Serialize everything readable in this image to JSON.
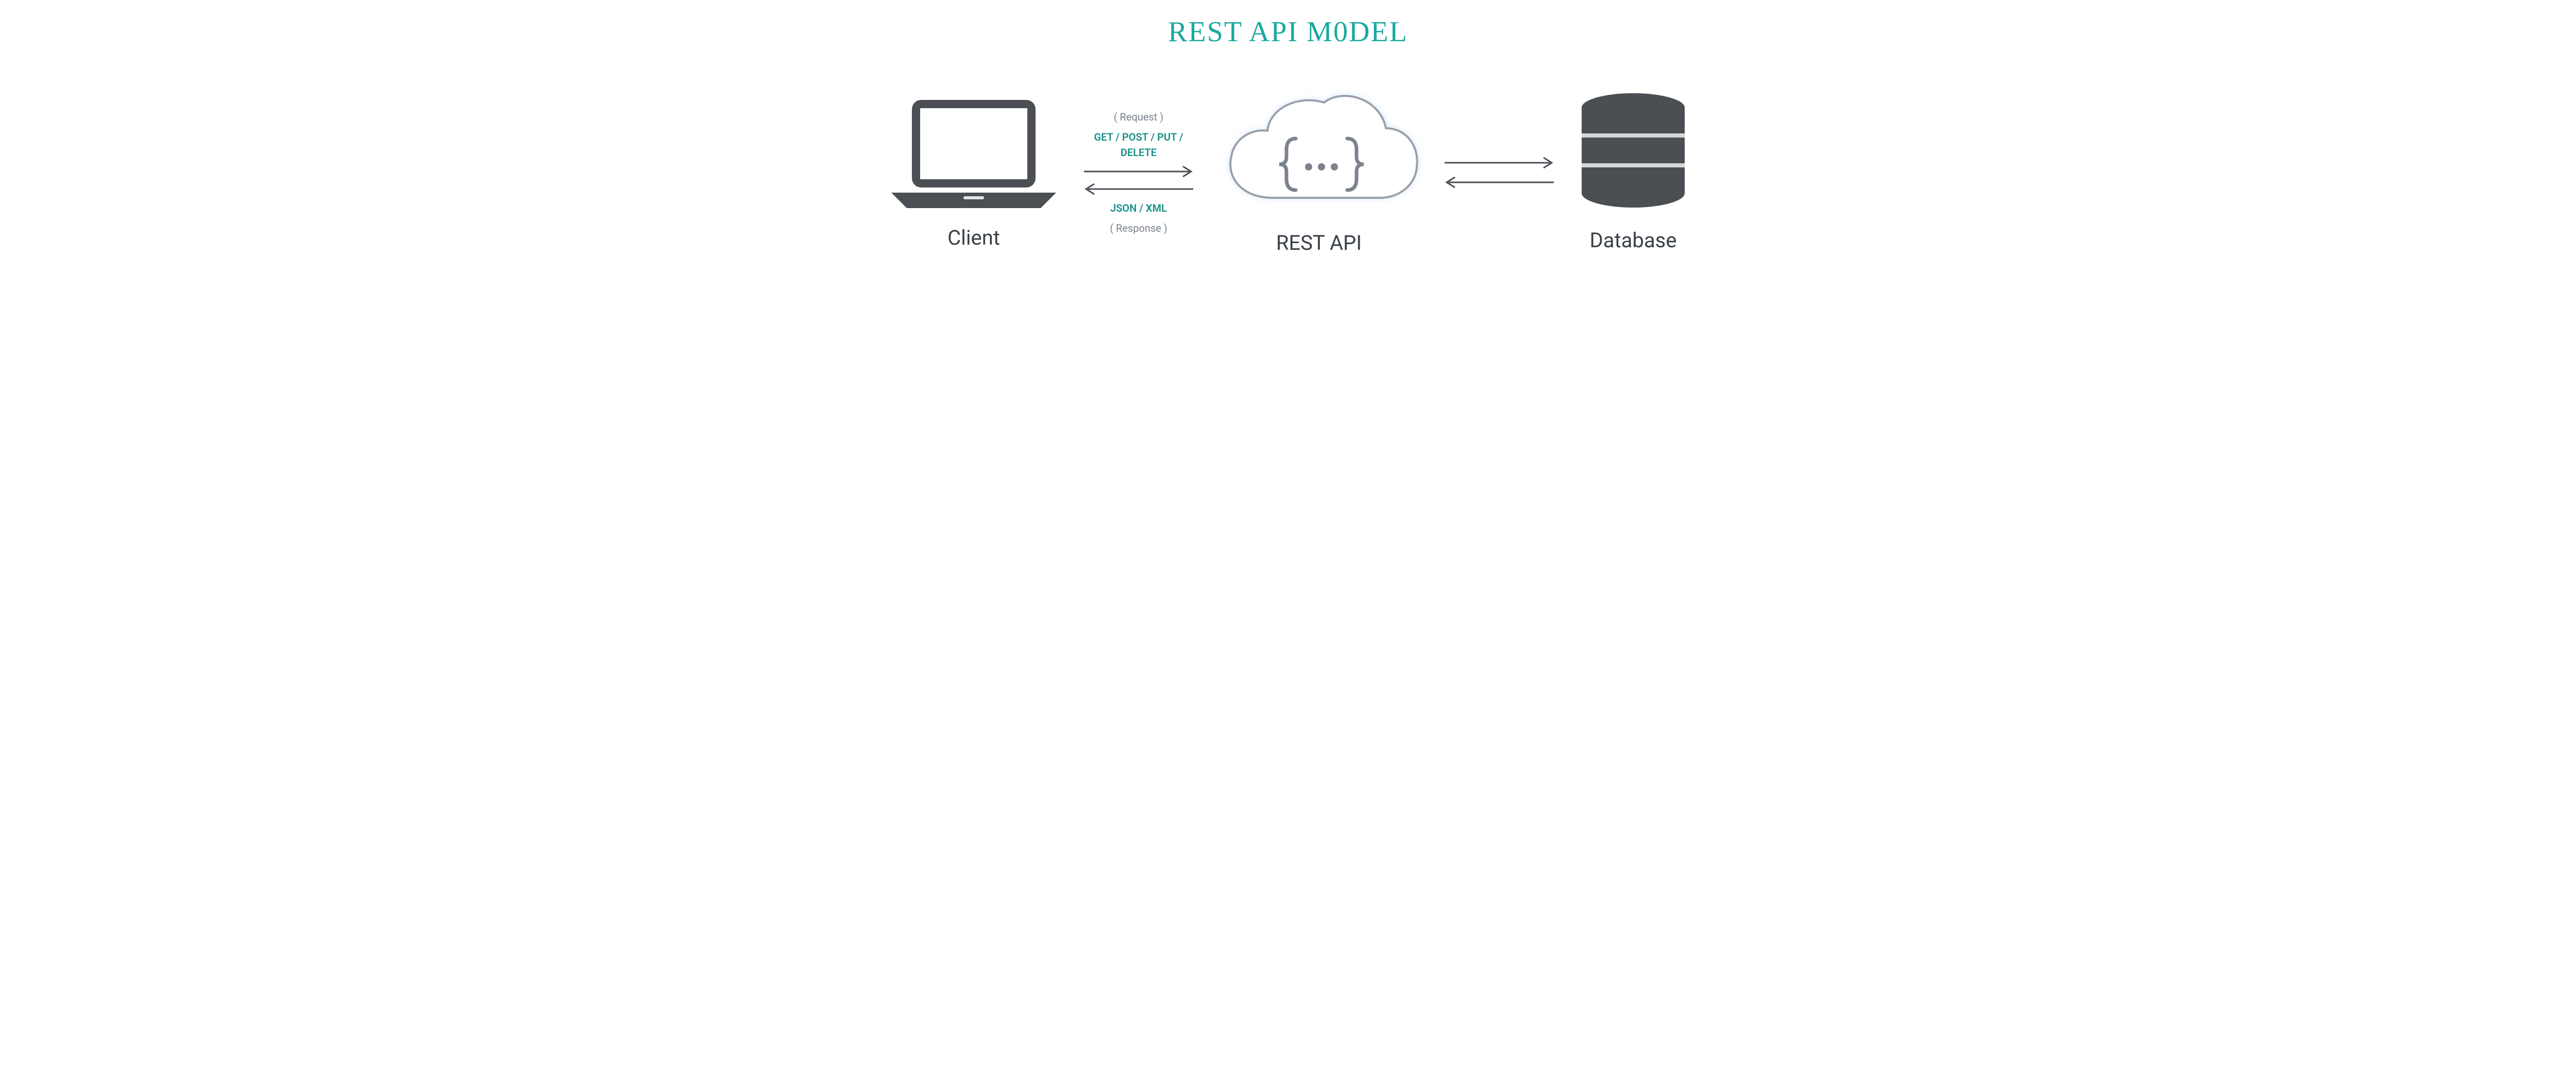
{
  "title": "REST API M0DEL",
  "client": {
    "label": "Client"
  },
  "api": {
    "label": "REST API"
  },
  "database": {
    "label": "Database"
  },
  "left_connector": {
    "request_caption": "( Request )",
    "methods": "GET / POST / PUT / DELETE",
    "formats": "JSON / XML",
    "response_caption": "( Response )"
  },
  "colors": {
    "accent": "#1aa99e",
    "text": "#3a4048",
    "muted": "#7a828c",
    "gray": "#4b4f54"
  }
}
